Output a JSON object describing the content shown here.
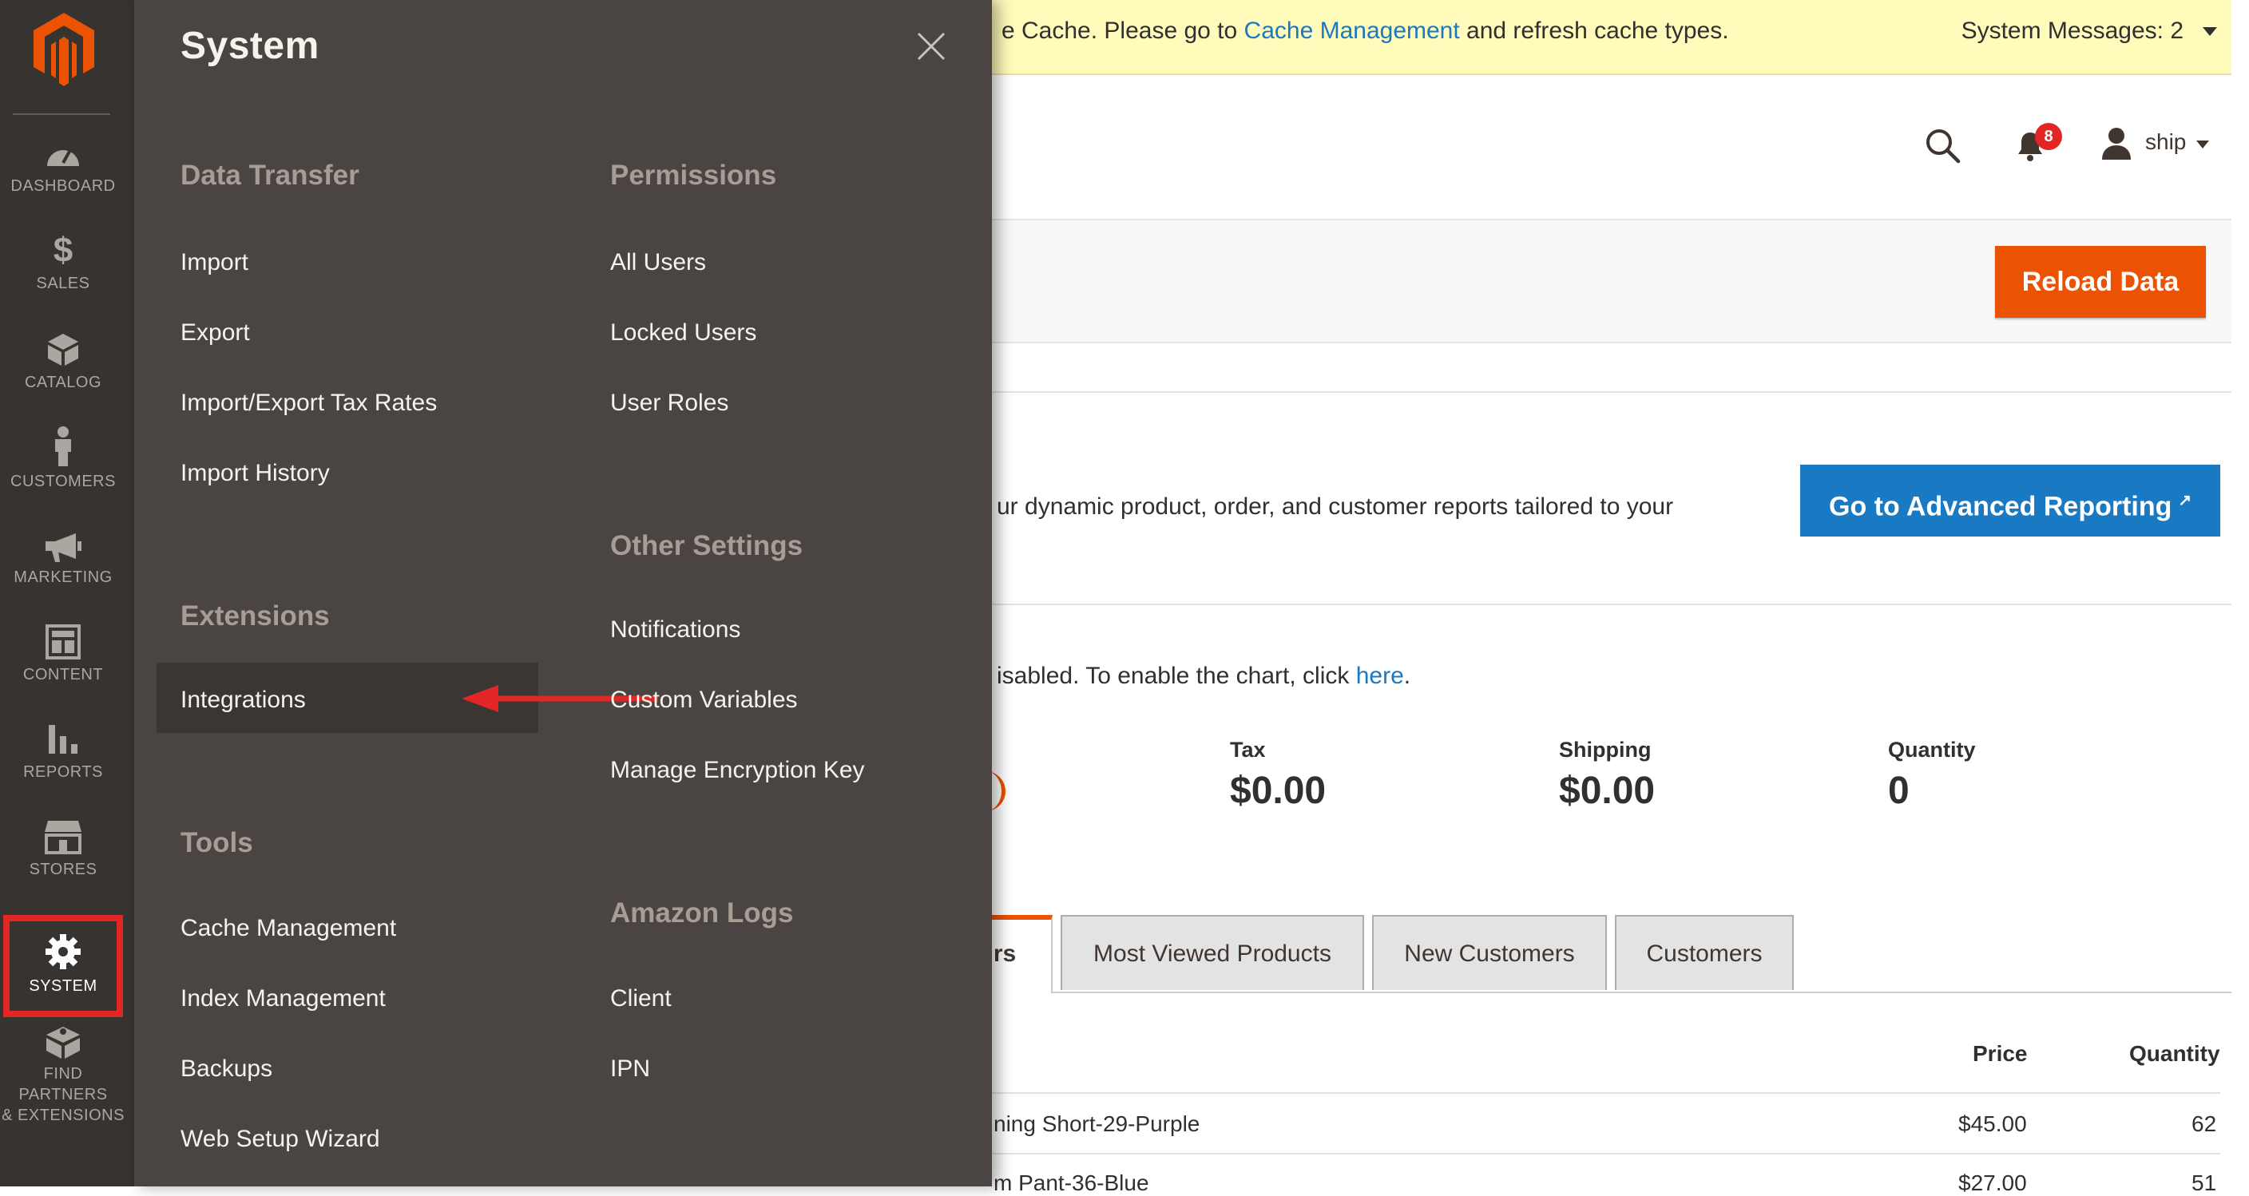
{
  "nav": {
    "items": [
      {
        "label": "DASHBOARD",
        "icon": "dashboard-icon"
      },
      {
        "label": "SALES",
        "icon": "dollar-icon"
      },
      {
        "label": "CATALOG",
        "icon": "box-icon"
      },
      {
        "label": "CUSTOMERS",
        "icon": "person-icon"
      },
      {
        "label": "MARKETING",
        "icon": "megaphone-icon"
      },
      {
        "label": "CONTENT",
        "icon": "layout-icon"
      },
      {
        "label": "REPORTS",
        "icon": "bar-chart-icon"
      },
      {
        "label": "STORES",
        "icon": "store-icon"
      },
      {
        "label": "SYSTEM",
        "icon": "gear-icon"
      },
      {
        "label_line1": "FIND PARTNERS",
        "label_line2": "& EXTENSIONS",
        "icon": "extensions-icon"
      }
    ],
    "active": "SYSTEM"
  },
  "flyout": {
    "title": "System",
    "groups": {
      "data_transfer": {
        "title": "Data Transfer",
        "links": [
          "Import",
          "Export",
          "Import/Export Tax Rates",
          "Import History"
        ]
      },
      "extensions": {
        "title": "Extensions",
        "links": [
          "Integrations"
        ]
      },
      "tools": {
        "title": "Tools",
        "links": [
          "Cache Management",
          "Index Management",
          "Backups",
          "Web Setup Wizard"
        ]
      },
      "permissions": {
        "title": "Permissions",
        "links": [
          "All Users",
          "Locked Users",
          "User Roles"
        ]
      },
      "other_settings": {
        "title": "Other Settings",
        "links": [
          "Notifications",
          "Custom Variables",
          "Manage Encryption Key"
        ]
      },
      "amazon_logs": {
        "title": "Amazon Logs",
        "links": [
          "Client",
          "IPN"
        ]
      }
    },
    "highlighted": "Integrations"
  },
  "system_message": {
    "prefix": "e Cache. Please go to ",
    "link": "Cache Management",
    "suffix": " and refresh cache types.",
    "count_label": "System Messages: 2"
  },
  "header": {
    "notification_count": "8",
    "user_name": "ship"
  },
  "toolbar": {
    "reload_label": "Reload Data"
  },
  "advanced_reporting": {
    "text": "ur dynamic product, order, and customer reports tailored to your",
    "button_label": "Go to Advanced Reporting"
  },
  "chart_message": {
    "prefix": "isabled. To enable the chart, click ",
    "link": "here",
    "suffix": "."
  },
  "stats": [
    {
      "label": "Tax",
      "value": "$0.00"
    },
    {
      "label": "Shipping",
      "value": "$0.00"
    },
    {
      "label": "Quantity",
      "value": "0"
    }
  ],
  "tabs": {
    "active_partial": "rs",
    "items": [
      "Most Viewed Products",
      "New Customers",
      "Customers"
    ]
  },
  "table": {
    "headers": {
      "price": "Price",
      "quantity": "Quantity"
    },
    "rows": [
      {
        "product": "ning Short-29-Purple",
        "price": "$45.00",
        "quantity": "62"
      },
      {
        "product": "m Pant-36-Blue",
        "price": "$27.00",
        "quantity": "51"
      }
    ]
  },
  "colors": {
    "accent": "#eb5202",
    "link": "#1979c3",
    "nav_bg": "#373330",
    "flyout_bg": "#4a4542",
    "highlight_red": "#e22626"
  }
}
